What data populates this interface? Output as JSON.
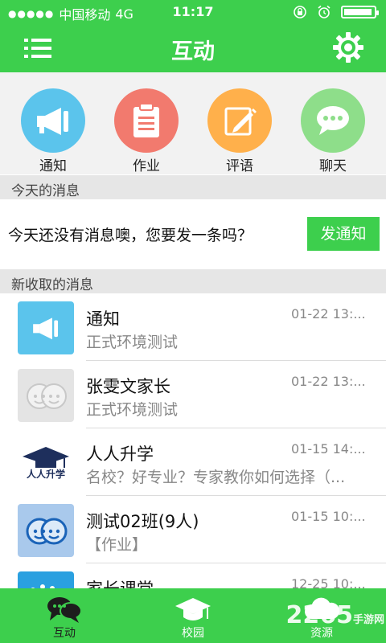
{
  "status": {
    "carrier": "中国移动",
    "network": "4G",
    "time": "11:17",
    "battery_level": 0.95
  },
  "nav": {
    "title": "互动"
  },
  "colors": {
    "brand_green": "#3dcf4d",
    "notice_blue": "#5bc4ec",
    "homework_red": "#f27a6e",
    "comment_orange": "#ffb04b",
    "chat_green": "#8ede8a"
  },
  "quick_actions": [
    {
      "label": "通知",
      "icon": "megaphone-icon"
    },
    {
      "label": "作业",
      "icon": "clipboard-icon"
    },
    {
      "label": "评语",
      "icon": "pencil-note-icon"
    },
    {
      "label": "聊天",
      "icon": "chat-bubble-icon"
    }
  ],
  "today": {
    "header": "今天的消息",
    "empty_text": "今天还没有消息噢，您要发一条吗？",
    "button_label": "发通知"
  },
  "received": {
    "header": "新收取的消息",
    "messages": [
      {
        "name": "通知",
        "preview": "正式环境测试",
        "time": "01-22 13:...",
        "avatar": "megaphone-avatar"
      },
      {
        "name": "张雯文家长",
        "preview": "正式环境测试",
        "time": "01-22 13:...",
        "avatar": "default-faces-avatar"
      },
      {
        "name": "人人升学",
        "preview": "名校？好专业？专家教你如何选择（...",
        "time": "01-15 14:...",
        "avatar": "graduation-logo-avatar",
        "logo_text": "人人升学"
      },
      {
        "name": "测试02班(9人)",
        "preview": "【作业】",
        "time": "01-15 10:...",
        "avatar": "group-faces-avatar"
      },
      {
        "name": "家长课堂",
        "preview": "",
        "time": "12-25 10:...",
        "avatar": "stars-avatar"
      }
    ]
  },
  "tabs": [
    {
      "label": "互动",
      "icon": "chat-tab-icon",
      "active": true
    },
    {
      "label": "校园",
      "icon": "graduation-cap-icon",
      "active": false
    },
    {
      "label": "资源",
      "icon": "cloud-icon",
      "active": false
    }
  ],
  "watermark": {
    "text": "2265",
    "sub": "手游网"
  }
}
